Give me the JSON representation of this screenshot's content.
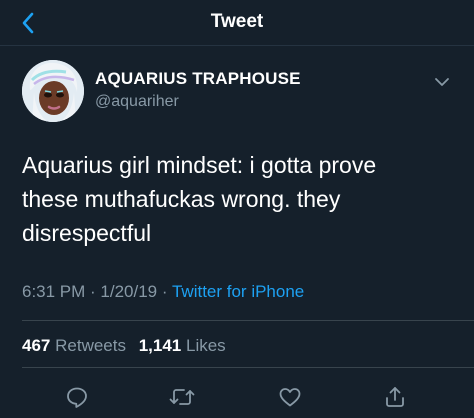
{
  "nav": {
    "title": "Tweet",
    "back_icon": "chevron-left-icon"
  },
  "author": {
    "name": "AQUARIUS TRAPHOUSE",
    "handle": "@aquariher",
    "avatar": "avatar-image"
  },
  "tweet": {
    "text_lines": [
      "Aquarius girl mindset: i gotta prove",
      "these muthafuckas wrong. they",
      "disrespectful"
    ],
    "time": "6:31 PM",
    "sep1": " · ",
    "date": "1/20/19",
    "sep2": " · ",
    "source": "Twitter for iPhone"
  },
  "stats": {
    "retweets_count": "467",
    "retweets_label": "Retweets",
    "likes_count": "1,141",
    "likes_label": "Likes"
  },
  "actions": [
    "reply-icon",
    "retweet-icon",
    "like-icon",
    "share-icon"
  ],
  "colors": {
    "background": "#15202b",
    "accent": "#1da1f2",
    "secondary_text": "#8899a6",
    "divider": "#38444d"
  }
}
